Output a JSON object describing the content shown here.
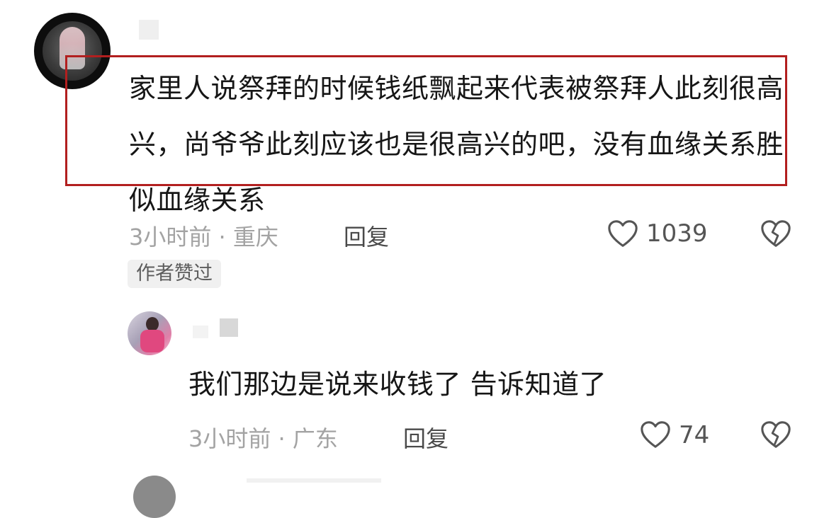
{
  "comments": [
    {
      "text": "家里人说祭拜的时候钱纸飘起来代表被祭拜人此刻很高兴，尚爷爷此刻应该也是很高兴的吧，没有血缘关系胜似血缘关系",
      "meta": "3小时前 · 重庆",
      "reply_label": "回复",
      "likes": "1039",
      "badge": "作者赞过"
    }
  ],
  "reply": {
    "text": "我们那边是说来收钱了 告诉知道了",
    "meta": "3小时前 · 广东",
    "reply_label": "回复",
    "likes": "74"
  },
  "colors": {
    "highlight": "#b21f1f",
    "text": "#161616",
    "meta": "#a3a3a3"
  },
  "icons": [
    "heart-icon",
    "dislike-icon"
  ]
}
